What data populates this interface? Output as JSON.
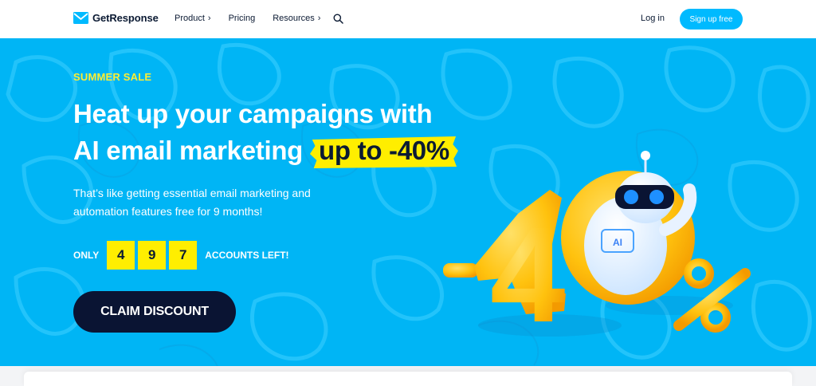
{
  "nav": {
    "brand": "GetResponse",
    "links": [
      {
        "label": "Product",
        "chevron": "›"
      },
      {
        "label": "Pricing",
        "chevron": ""
      },
      {
        "label": "Resources",
        "chevron": "›"
      }
    ],
    "login_label": "Log in",
    "signup_label": "Sign up free",
    "accent_color": "#00baff"
  },
  "hero": {
    "eyebrow": "SUMMER SALE",
    "headline_line1": "Heat up your campaigns with",
    "headline_line2": "AI email marketing",
    "headline_highlight": "up to -40%",
    "subtext": "That’s like getting essential email marketing and automation features free for 9 months!",
    "counter_prefix": "ONLY",
    "counter_digits": [
      "4",
      "9",
      "7"
    ],
    "counter_suffix": "ACCOUNTS LEFT!",
    "cta_label": "CLAIM DISCOUNT",
    "background_color": "#00b5f5",
    "highlight_color": "#ffee00",
    "cta_color": "#0a1433"
  },
  "promo_art": {
    "minus": "-",
    "number": "4",
    "zero": "0",
    "percent": "%",
    "robot_chip_label": "AI",
    "color": "#ffc20e"
  }
}
